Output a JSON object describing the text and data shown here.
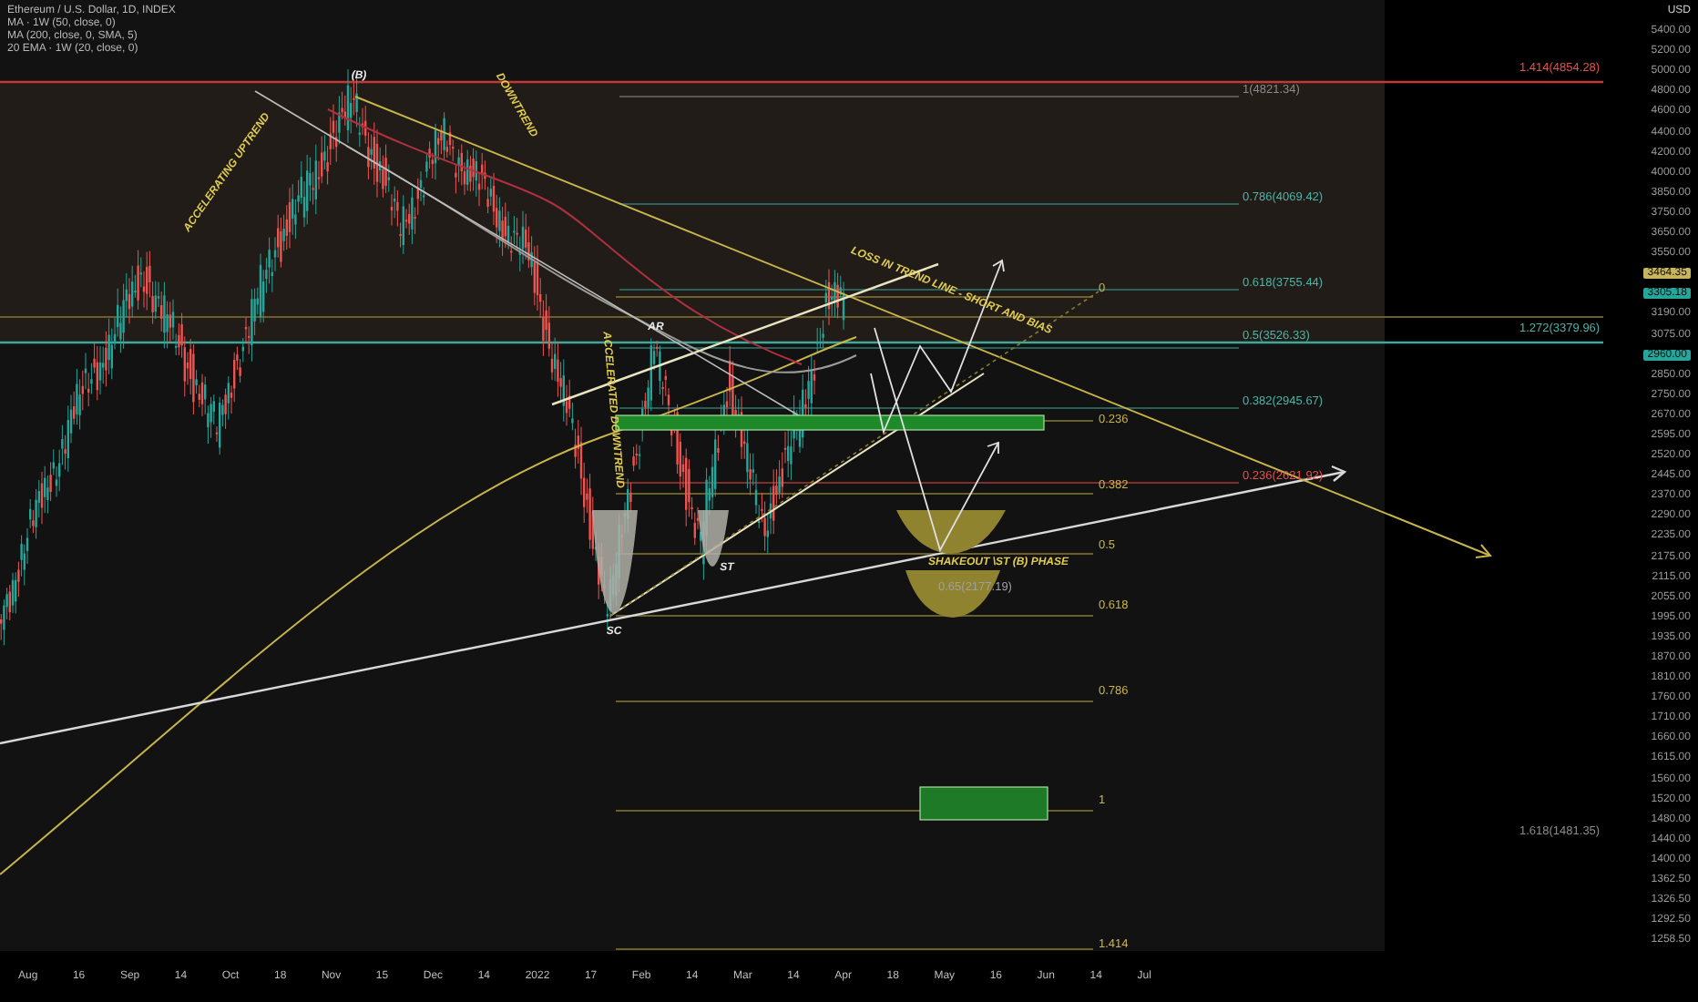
{
  "legend": [
    "Ethereum / U.S. Dollar, 1D, INDEX",
    "MA · 1W (50, close, 0)",
    "MA (200, close, 0, SMA, 5)",
    "20 EMA · 1W (20, close, 0)"
  ],
  "annotations": [
    {
      "text": "(B)"
    },
    {
      "text": "ACCELERATING UPTREND"
    },
    {
      "text": "DOWNTREND"
    },
    {
      "text": "ACCELERATED DOWNTREND"
    },
    {
      "text": "AR"
    },
    {
      "text": "SC"
    },
    {
      "text": "ST"
    },
    {
      "text": "SHAKEOUT \\ST (B) PHASE"
    },
    {
      "text": "LOSS IN TREND LINE - SHORT AND BIAS"
    }
  ],
  "fib_labels": [
    {
      "text": "1.414(4854.28)",
      "color": "#e0524a"
    },
    {
      "text": "1(4821.34)",
      "color": "#8a8a8a"
    },
    {
      "text": "0.786(4069.42)",
      "color": "#4fb3a5"
    },
    {
      "text": "0",
      "color": "#c8b44a"
    },
    {
      "text": "0.618(3755.44)",
      "color": "#4fb3a5"
    },
    {
      "text": "0.5(3526.33)",
      "color": "#4fb3a5"
    },
    {
      "text": "1.272(3379.96)",
      "color": "#4fb3a5"
    },
    {
      "text": "0.382(2945.67)",
      "color": "#4fb3a5"
    },
    {
      "text": "0.236",
      "color": "#c8b44a"
    },
    {
      "text": "0.382",
      "color": "#c8b44a"
    },
    {
      "text": "0.236(2621.92)",
      "color": "#e0524a"
    },
    {
      "text": "0.5",
      "color": "#c8b44a"
    },
    {
      "text": "0.65(2177.19)",
      "color": "#a0a0a0"
    },
    {
      "text": "0.618",
      "color": "#c8b44a"
    },
    {
      "text": "0.786",
      "color": "#c8b44a"
    },
    {
      "text": "1",
      "color": "#c8b44a"
    },
    {
      "text": "1.618(1481.35)",
      "color": "#8a8a8a"
    },
    {
      "text": "1.414",
      "color": "#c8b44a"
    }
  ],
  "price_axis": {
    "currency": "USD",
    "labels": [
      {
        "text": "5400.00",
        "kind": "plain"
      },
      {
        "text": "5200.00",
        "kind": "plain"
      },
      {
        "text": "5000.00",
        "kind": "plain"
      },
      {
        "text": "4800.00",
        "kind": "plain"
      },
      {
        "text": "4600.00",
        "kind": "plain"
      },
      {
        "text": "4400.00",
        "kind": "plain"
      },
      {
        "text": "4200.00",
        "kind": "plain"
      },
      {
        "text": "4000.00",
        "kind": "plain"
      },
      {
        "text": "3850.00",
        "kind": "plain"
      },
      {
        "text": "3750.00",
        "kind": "plain"
      },
      {
        "text": "3650.00",
        "kind": "plain"
      },
      {
        "text": "3550.00",
        "kind": "plain"
      },
      {
        "text": "3464.35",
        "kind": "badge",
        "color": "#c8b560"
      },
      {
        "text": "3305.18",
        "kind": "badge",
        "color": "#26a69a"
      },
      {
        "text": "3190.00",
        "kind": "plain"
      },
      {
        "text": "3075.00",
        "kind": "plain"
      },
      {
        "text": "2960.00",
        "kind": "badge",
        "color": "#26a69a"
      },
      {
        "text": "2850.00",
        "kind": "plain"
      },
      {
        "text": "2750.00",
        "kind": "plain"
      },
      {
        "text": "2670.00",
        "kind": "plain"
      },
      {
        "text": "2595.00",
        "kind": "plain"
      },
      {
        "text": "2520.00",
        "kind": "plain"
      },
      {
        "text": "2445.00",
        "kind": "plain"
      },
      {
        "text": "2370.00",
        "kind": "plain"
      },
      {
        "text": "2290.00",
        "kind": "plain"
      },
      {
        "text": "2235.00",
        "kind": "plain"
      },
      {
        "text": "2175.00",
        "kind": "plain"
      },
      {
        "text": "2115.00",
        "kind": "plain"
      },
      {
        "text": "2055.00",
        "kind": "plain"
      },
      {
        "text": "1995.00",
        "kind": "plain"
      },
      {
        "text": "1935.00",
        "kind": "plain"
      },
      {
        "text": "1870.00",
        "kind": "plain"
      },
      {
        "text": "1810.00",
        "kind": "plain"
      },
      {
        "text": "1760.00",
        "kind": "plain"
      },
      {
        "text": "1710.00",
        "kind": "plain"
      },
      {
        "text": "1660.00",
        "kind": "plain"
      },
      {
        "text": "1615.00",
        "kind": "plain"
      },
      {
        "text": "1560.00",
        "kind": "plain"
      },
      {
        "text": "1520.00",
        "kind": "plain"
      },
      {
        "text": "1480.00",
        "kind": "plain"
      },
      {
        "text": "1440.00",
        "kind": "plain"
      },
      {
        "text": "1400.00",
        "kind": "plain"
      },
      {
        "text": "1362.50",
        "kind": "plain"
      },
      {
        "text": "1326.50",
        "kind": "plain"
      },
      {
        "text": "1292.50",
        "kind": "plain"
      },
      {
        "text": "1258.50",
        "kind": "plain"
      }
    ]
  },
  "time_axis": [
    "Aug",
    "16",
    "Sep",
    "14",
    "Oct",
    "18",
    "Nov",
    "15",
    "Dec",
    "14",
    "2022",
    "17",
    "Feb",
    "14",
    "Mar",
    "14",
    "Apr",
    "18",
    "May",
    "16",
    "Jun",
    "14",
    "Jul"
  ]
}
